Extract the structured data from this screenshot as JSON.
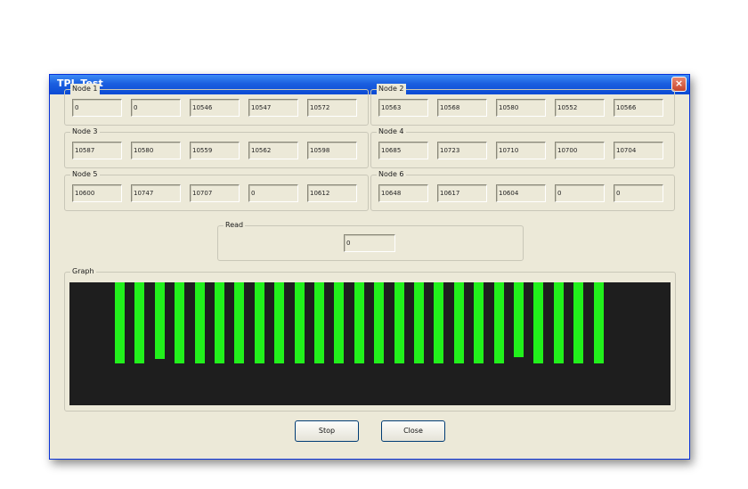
{
  "window": {
    "title": "TPL Test",
    "close_glyph": "×"
  },
  "nodes": [
    {
      "label": "Node 1",
      "values": [
        "0",
        "0",
        "10546",
        "10547",
        "10572"
      ]
    },
    {
      "label": "Node 2",
      "values": [
        "10563",
        "10568",
        "10580",
        "10552",
        "10566"
      ]
    },
    {
      "label": "Node 3",
      "values": [
        "10587",
        "10580",
        "10559",
        "10562",
        "10598"
      ]
    },
    {
      "label": "Node 4",
      "values": [
        "10685",
        "10723",
        "10710",
        "10700",
        "10704"
      ]
    },
    {
      "label": "Node 5",
      "values": [
        "10600",
        "10747",
        "10707",
        "0",
        "10612"
      ]
    },
    {
      "label": "Node 6",
      "values": [
        "10648",
        "10617",
        "10604",
        "0",
        "0"
      ]
    }
  ],
  "read": {
    "label": "Read",
    "value": "0"
  },
  "graph": {
    "label": "Graph",
    "bar_color": "#22f01c",
    "background": "#1e1e1e",
    "bar_levels": [
      0.66,
      0.66,
      0.62,
      0.66,
      0.66,
      0.66,
      0.66,
      0.66,
      0.66,
      0.66,
      0.66,
      0.66,
      0.66,
      0.66,
      0.66,
      0.66,
      0.66,
      0.66,
      0.66,
      0.66,
      0.61,
      0.66,
      0.66,
      0.66,
      0.66
    ]
  },
  "buttons": {
    "stop": "Stop",
    "close": "Close"
  }
}
